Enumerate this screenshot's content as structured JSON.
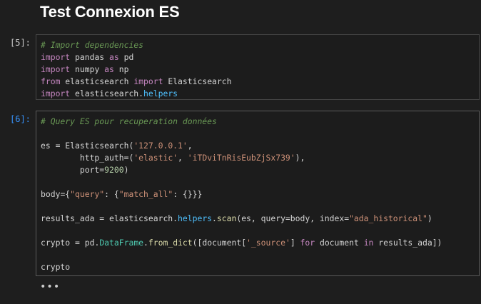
{
  "notebook": {
    "title": "Test Connexion ES",
    "more_label": "•••"
  },
  "cells": [
    {
      "prompt": "[5]:",
      "lines": [
        [
          [
            "cm",
            "# Import dependencies"
          ]
        ],
        [
          [
            "kw",
            "import"
          ],
          [
            "op",
            " pandas "
          ],
          [
            "kw",
            "as"
          ],
          [
            "op",
            " pd"
          ]
        ],
        [
          [
            "kw",
            "import"
          ],
          [
            "op",
            " numpy "
          ],
          [
            "kw",
            "as"
          ],
          [
            "op",
            " np"
          ]
        ],
        [
          [
            "kw",
            "from"
          ],
          [
            "op",
            " elasticsearch "
          ],
          [
            "kw",
            "import"
          ],
          [
            "op",
            " Elasticsearch"
          ]
        ],
        [
          [
            "kw",
            "import"
          ],
          [
            "op",
            " elasticsearch."
          ],
          [
            "prop",
            "helpers"
          ]
        ]
      ]
    },
    {
      "prompt": "[6]:",
      "lines": [
        [
          [
            "cm",
            "# Query ES pour recuperation données"
          ]
        ],
        [],
        [
          [
            "op",
            "es "
          ],
          [
            "op",
            "="
          ],
          [
            "op",
            " Elasticsearch("
          ],
          [
            "str",
            "'127.0.0.1'"
          ],
          [
            "op",
            ","
          ]
        ],
        [
          [
            "op",
            "        http_auth"
          ],
          [
            "op",
            "="
          ],
          [
            "op",
            "("
          ],
          [
            "str",
            "'elastic'"
          ],
          [
            "op",
            ", "
          ],
          [
            "str",
            "'iTDviTnRisEubZjSx739'"
          ],
          [
            "op",
            "),"
          ]
        ],
        [
          [
            "op",
            "        port"
          ],
          [
            "op",
            "="
          ],
          [
            "num",
            "9200"
          ],
          [
            "op",
            ")"
          ]
        ],
        [],
        [
          [
            "op",
            "body"
          ],
          [
            "op",
            "="
          ],
          [
            "op",
            "{"
          ],
          [
            "str",
            "\"query\""
          ],
          [
            "op",
            ": {"
          ],
          [
            "str",
            "\"match_all\""
          ],
          [
            "op",
            ": {}}}"
          ]
        ],
        [],
        [
          [
            "op",
            "results_ada "
          ],
          [
            "op",
            "="
          ],
          [
            "op",
            " elasticsearch."
          ],
          [
            "prop",
            "helpers"
          ],
          [
            "op",
            "."
          ],
          [
            "fn",
            "scan"
          ],
          [
            "op",
            "(es, query"
          ],
          [
            "op",
            "="
          ],
          [
            "op",
            "body, index"
          ],
          [
            "op",
            "="
          ],
          [
            "str",
            "\"ada_historical\""
          ],
          [
            "op",
            ")"
          ]
        ],
        [],
        [
          [
            "op",
            "crypto "
          ],
          [
            "op",
            "="
          ],
          [
            "op",
            " pd."
          ],
          [
            "cls",
            "DataFrame"
          ],
          [
            "op",
            "."
          ],
          [
            "fn",
            "from_dict"
          ],
          [
            "op",
            "([document["
          ],
          [
            "str",
            "'_source'"
          ],
          [
            "op",
            "] "
          ],
          [
            "kw",
            "for"
          ],
          [
            "op",
            " document "
          ],
          [
            "kw",
            "in"
          ],
          [
            "op",
            " results_ada])"
          ]
        ],
        [],
        [
          [
            "op",
            "crypto"
          ]
        ]
      ]
    }
  ]
}
